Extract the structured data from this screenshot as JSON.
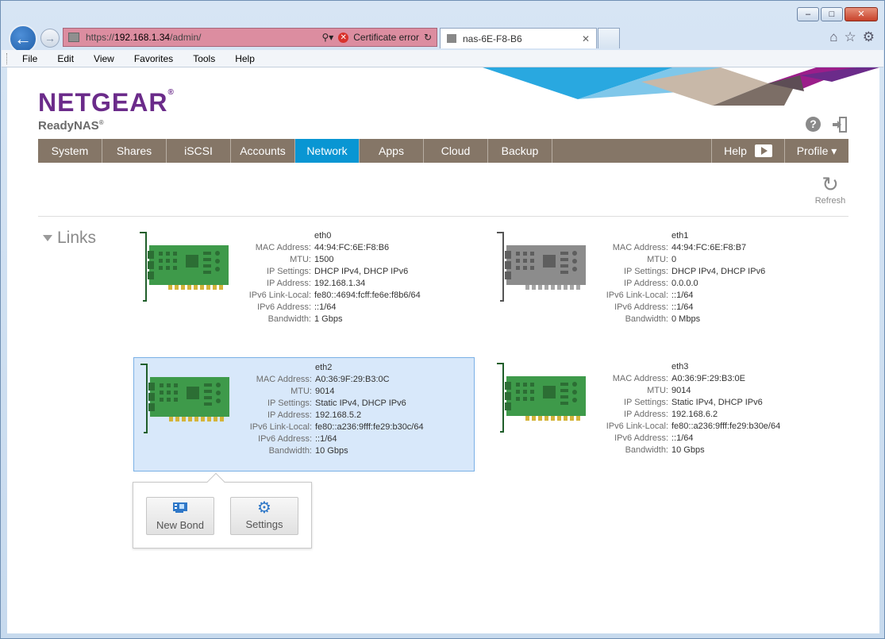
{
  "browser": {
    "address": {
      "protocol": "https://",
      "host": "192.168.1.34",
      "path": "/admin/",
      "cert_error": "Certificate error"
    },
    "tab_title": "nas-6E-F8-B6",
    "menu": [
      "File",
      "Edit",
      "View",
      "Favorites",
      "Tools",
      "Help"
    ]
  },
  "app": {
    "brand": "NETGEAR",
    "product": "ReadyNAS",
    "nav": [
      "System",
      "Shares",
      "iSCSI",
      "Accounts",
      "Network",
      "Apps",
      "Cloud",
      "Backup"
    ],
    "active_nav": "Network",
    "help_label": "Help",
    "profile_label": "Profile ▾",
    "refresh_label": "Refresh",
    "section_title": "Links"
  },
  "labels": {
    "mac": "MAC Address:",
    "mtu": "MTU:",
    "ip_settings": "IP Settings:",
    "ip_address": "IP Address:",
    "ipv6_link_local": "IPv6 Link-Local:",
    "ipv6_address": "IPv6 Address:",
    "bandwidth": "Bandwidth:"
  },
  "links": [
    {
      "name": "eth0",
      "mac": "44:94:FC:6E:F8:B6",
      "mtu": "1500",
      "ip_settings": "DHCP IPv4, DHCP IPv6",
      "ip_address": "192.168.1.34",
      "ipv6_link_local": "fe80::4694:fcff:fe6e:f8b6/64",
      "ipv6_address": "::1/64",
      "bandwidth": "1 Gbps"
    },
    {
      "name": "eth1",
      "mac": "44:94:FC:6E:F8:B7",
      "mtu": "0",
      "ip_settings": "DHCP IPv4, DHCP IPv6",
      "ip_address": "0.0.0.0",
      "ipv6_link_local": "::1/64",
      "ipv6_address": "::1/64",
      "bandwidth": "0 Mbps"
    },
    {
      "name": "eth2",
      "mac": "A0:36:9F:29:B3:0C",
      "mtu": "9014",
      "ip_settings": "Static IPv4, DHCP IPv6",
      "ip_address": "192.168.5.2",
      "ipv6_link_local": "fe80::a236:9fff:fe29:b30c/64",
      "ipv6_address": "::1/64",
      "bandwidth": "10 Gbps"
    },
    {
      "name": "eth3",
      "mac": "A0:36:9F:29:B3:0E",
      "mtu": "9014",
      "ip_settings": "Static IPv4, DHCP IPv6",
      "ip_address": "192.168.6.2",
      "ipv6_link_local": "fe80::a236:9fff:fe29:b30e/64",
      "ipv6_address": "::1/64",
      "bandwidth": "10 Gbps"
    }
  ],
  "popover": {
    "new_bond": "New Bond",
    "settings": "Settings"
  },
  "colors": {
    "nav_bg": "#857667",
    "nav_active": "#0996d3",
    "brand": "#6b2b8a",
    "nic_active": "#3e9a4a",
    "nic_inactive": "#8c8c8c",
    "selected_bg": "#d8e8fa"
  }
}
